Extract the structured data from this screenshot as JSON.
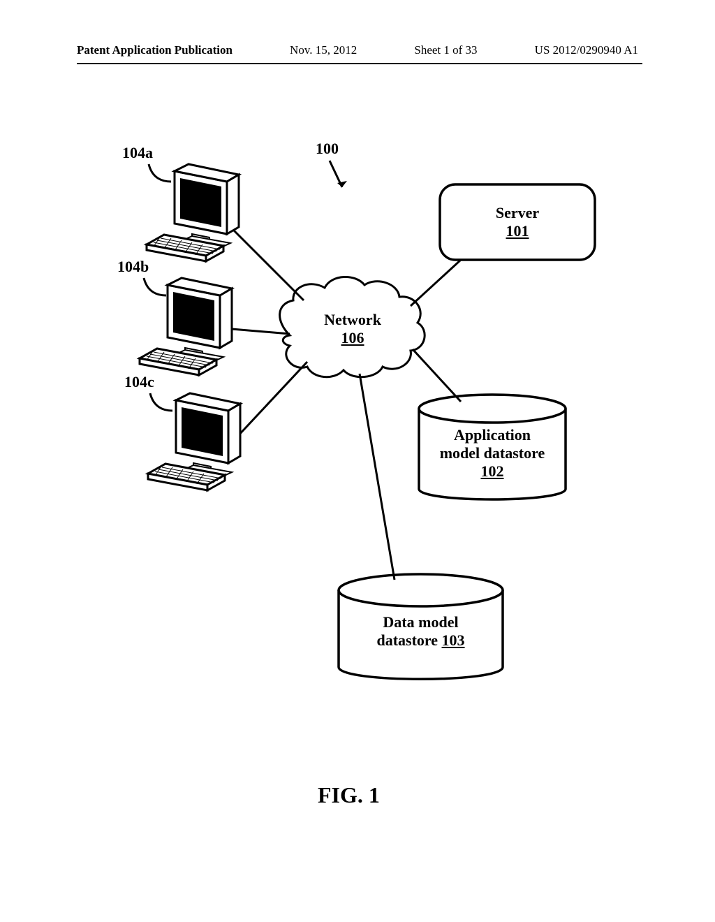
{
  "header": {
    "left": "Patent Application Publication",
    "date": "Nov. 15, 2012",
    "sheet": "Sheet 1 of 33",
    "pubno": "US 2012/0290940 A1"
  },
  "labels": {
    "l104a": "104a",
    "l104b": "104b",
    "l104c": "104c",
    "l100": "100",
    "server_word": "Server",
    "server_num": "101",
    "network_word": "Network",
    "network_num": "106",
    "app1": "Application",
    "app2": "model datastore",
    "app_num": "102",
    "data1": "Data model",
    "data2_prefix": "datastore ",
    "data_num": "103",
    "figure": "FIG. 1"
  }
}
